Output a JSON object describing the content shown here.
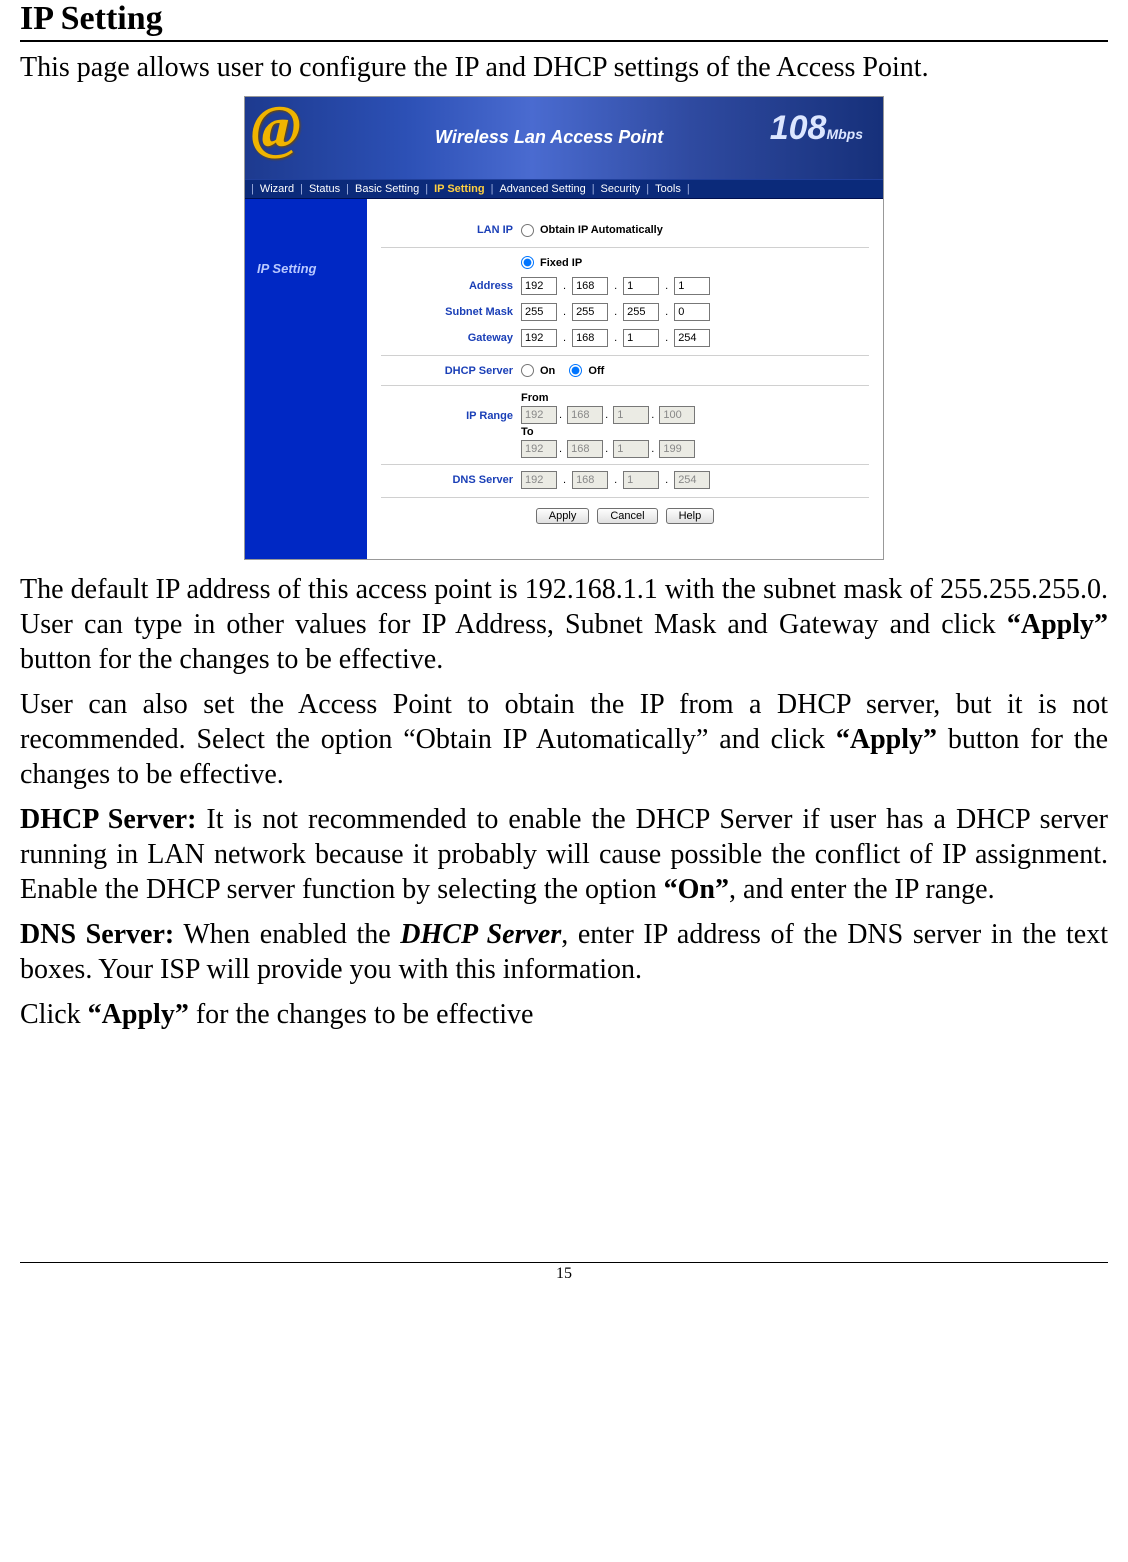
{
  "title": "IP Setting",
  "intro": "This page allows user to configure the IP and DHCP settings of the Access Point.",
  "banner": {
    "at_symbol": "@",
    "product_line": "Wireless Lan Access Point",
    "speed_num": "108",
    "speed_unit": "Mbps"
  },
  "nav": {
    "items": [
      "Wizard",
      "Status",
      "Basic Setting",
      "IP Setting",
      "Advanced Setting",
      "Security",
      "Tools"
    ],
    "active_index": 3,
    "sep": "|"
  },
  "sidebar": {
    "title": "IP Setting"
  },
  "form": {
    "lan_ip_label": "LAN IP",
    "obtain_label": "Obtain IP Automatically",
    "fixed_label": "Fixed IP",
    "address_label": "Address",
    "address": [
      "192",
      "168",
      "1",
      "1"
    ],
    "subnet_label": "Subnet Mask",
    "subnet": [
      "255",
      "255",
      "255",
      "0"
    ],
    "gateway_label": "Gateway",
    "gateway": [
      "192",
      "168",
      "1",
      "254"
    ],
    "dhcp_label": "DHCP Server",
    "dhcp_on": "On",
    "dhcp_off": "Off",
    "iprange_label": "IP Range",
    "from_label": "From",
    "from": [
      "192",
      "168",
      "1",
      "100"
    ],
    "to_label": "To",
    "to": [
      "192",
      "168",
      "1",
      "199"
    ],
    "dns_label": "DNS Server",
    "dns": [
      "192",
      "168",
      "1",
      "254"
    ],
    "apply": "Apply",
    "cancel": "Cancel",
    "help": "Help"
  },
  "para1_a": "The default IP address of this access point is 192.168.1.1 with the subnet mask of 255.255.255.0. User can type in other values for IP Address, Subnet Mask and Gateway and click ",
  "para1_b": "“Apply”",
  "para1_c": " button for the changes to be effective.",
  "para2_a": "User can also set the Access Point to obtain the IP from a DHCP server, but it is not recommended. Select the option “Obtain IP Automatically” and click ",
  "para2_b": "“Apply”",
  "para2_c": " button for the changes to be effective.",
  "para3_a": "DHCP Server:",
  "para3_b": " It is not recommended to enable the DHCP Server if user has a DHCP server running in LAN network because it probably will cause possible the conflict of IP assignment. Enable the DHCP server function by selecting the option ",
  "para3_c": "“On”",
  "para3_d": ", and enter the IP range.",
  "para4_a": "DNS Server:",
  "para4_b": " When enabled the ",
  "para4_c": "DHCP Server",
  "para4_d": ", enter IP address of the DNS server in the text boxes. Your ISP will provide you with this information.",
  "para5_a": "Click ",
  "para5_b": "“Apply”",
  "para5_c": " for the changes to be effective",
  "page_num": "15"
}
